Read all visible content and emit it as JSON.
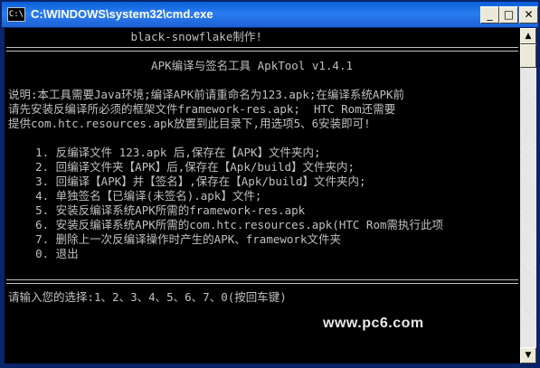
{
  "window": {
    "title": "C:\\WINDOWS\\system32\\cmd.exe",
    "icon_label": "C:\\",
    "buttons": {
      "minimize": "_",
      "maximize": "□",
      "close": "✕"
    }
  },
  "console": {
    "lines": [
      "                  black-snowflake制作!",
      "",
      "                     APK编译与签名工具 ApkTool v1.4.1",
      "",
      "说明:本工具需要Java环境;编译APK前请重命名为123.apk;在编译系统APK前",
      "请先安装反编译所必须的框架文件framework-res.apk;  HTC Rom还需要",
      "提供com.htc.resources.apk放置到此目录下,用选项5、6安装即可!",
      "",
      "    1. 反编译文件 123.apk 后,保存在【APK】文件夹内;",
      "    2. 回编译文件夹【APK】后,保存在【Apk/build】文件夹内;",
      "    3. 回编译【APK】并【签名】,保存在【Apk/build】文件夹内;",
      "    4. 单独签名【已编译(未签名).apk】文件;",
      "    5. 安装反编译系统APK所需的framework-res.apk",
      "    6. 安装反编译系统APK所需的com.htc.resources.apk(HTC Rom需执行此项",
      "    7. 删除上一次反编译操作时产生的APK、framework文件夹",
      "    0. 退出",
      "",
      "",
      "请输入您的选择:1、2、3、4、5、6、7、0(按回车键)"
    ],
    "watermark": "www.pc6.com"
  },
  "scrollbar": {
    "up_arrow": "▲",
    "down_arrow": "▼"
  }
}
